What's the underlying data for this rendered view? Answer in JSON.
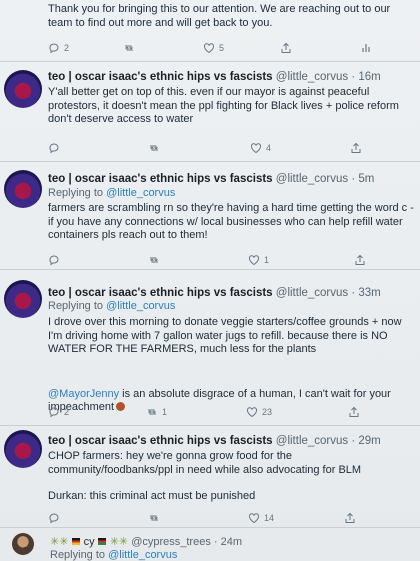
{
  "top": {
    "text": "Thank you for bringing this to our attention. We are reaching out to our team to find out more and will get back to you.",
    "reply_count": "2",
    "like_count": "5"
  },
  "tweets": [
    {
      "name": "teo | oscar isaac's ethnic hips vs fascists",
      "handle": "@little_corvus · 16m",
      "reply_prefix": "",
      "reply_to": "",
      "text": "Y'all better get on top of this. even if our mayor is against peaceful protestors, it doesn't mean the ppl fighting for Black lives + police reform don't deserve access to water",
      "replies": "",
      "retweets": "",
      "likes": "4"
    },
    {
      "name": "teo | oscar isaac's ethnic hips vs fascists",
      "handle": "@little_corvus · 5m",
      "reply_prefix": "Replying to ",
      "reply_to": "@little_corvus",
      "text": "farmers are scrambling rn so they're having a hard time getting the word c - if you have any connections w/ local businesses who can help refill water containers pls reach out to them!",
      "replies": "",
      "retweets": "",
      "likes": "1"
    },
    {
      "name": "teo | oscar isaac's ethnic hips vs fascists",
      "handle": "@little_corvus · 33m",
      "reply_prefix": "Replying to ",
      "reply_to": "@little_corvus",
      "text": "I drove over this morning to donate veggie starters/coffee grounds + now I'm driving home with 7 gallon water jugs to refill. because there is NO WATER FOR THE FARMERS, much less for the plants",
      "mention": "@MayorJenny",
      "text2": " is an absolute disgrace of a human, I can't wait for your impeachment",
      "replies": "2",
      "retweets": "1",
      "likes": "23"
    },
    {
      "name": "teo | oscar isaac's ethnic hips vs fascists",
      "handle": "@little_corvus · 29m",
      "reply_prefix": "",
      "reply_to": "",
      "text": "CHOP farmers: hey we're gonna grow food for the community/foodbanks/ppl in need while also advocating for BLM",
      "text2": "Durkan: this criminal act must be punished",
      "replies": "",
      "retweets": "",
      "likes": "14"
    }
  ],
  "last": {
    "handle": "@cypress_trees · 24m",
    "name_fragment": "cy",
    "reply_prefix": "Replying to ",
    "reply_to": "@little_corvus"
  },
  "colors": {
    "link": "#2a7fc1",
    "avatar": "#3c2a86",
    "divider": "#c9cfd4"
  }
}
